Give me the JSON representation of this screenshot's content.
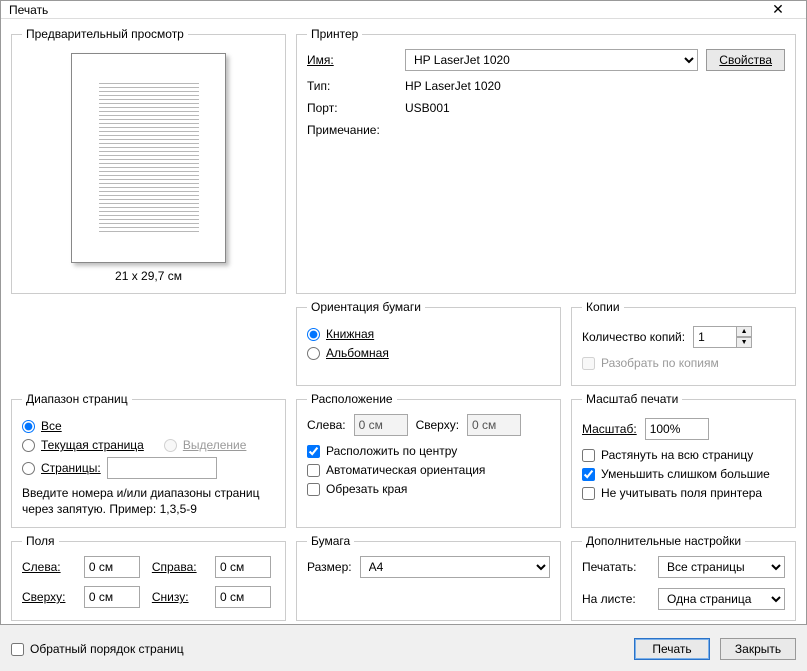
{
  "window": {
    "title": "Печать"
  },
  "preview": {
    "legend": "Предварительный просмотр",
    "dims": "21 x 29,7 см"
  },
  "printer": {
    "legend": "Принтер",
    "name_label": "Имя:",
    "name_value": "HP LaserJet 1020",
    "properties_btn": "Свойства",
    "type_label": "Тип:",
    "type_value": "HP LaserJet 1020",
    "port_label": "Порт:",
    "port_value": "USB001",
    "note_label": "Примечание:",
    "note_value": ""
  },
  "orientation": {
    "legend": "Ориентация бумаги",
    "portrait": "Книжная",
    "landscape": "Альбомная"
  },
  "copies": {
    "legend": "Копии",
    "count_label": "Количество копий:",
    "count_value": "1",
    "collate_label": "Разобрать по копиям"
  },
  "range": {
    "legend": "Диапазон страниц",
    "all": "Все",
    "current": "Текущая страница",
    "selection": "Выделение",
    "pages": "Страницы:",
    "pages_value": "",
    "hint": "Введите номера и/или диапазоны страниц через запятую. Пример: 1,3,5-9"
  },
  "layout": {
    "legend": "Расположение",
    "left_label": "Слева:",
    "left_value": "0 см",
    "top_label": "Сверху:",
    "top_value": "0 см",
    "center": "Расположить по центру",
    "auto_orient": "Автоматическая ориентация",
    "crop": "Обрезать края"
  },
  "scale": {
    "legend": "Масштаб печати",
    "scale_label": "Масштаб:",
    "scale_value": "100%",
    "fit": "Растянуть на всю страницу",
    "shrink": "Уменьшить слишком большие",
    "ignore_margins": "Не учитывать поля принтера"
  },
  "margins": {
    "legend": "Поля",
    "left_label": "Слева:",
    "left_value": "0 см",
    "right_label": "Справа:",
    "right_value": "0 см",
    "top_label": "Сверху:",
    "top_value": "0 см",
    "bottom_label": "Снизу:",
    "bottom_value": "0 см"
  },
  "paper": {
    "legend": "Бумага",
    "size_label": "Размер:",
    "size_value": "A4"
  },
  "extra": {
    "legend": "Дополнительные настройки",
    "print_label": "Печатать:",
    "print_value": "Все страницы",
    "sheet_label": "На листе:",
    "sheet_value": "Одна страница"
  },
  "bottom": {
    "reverse": "Обратный порядок страниц",
    "print_btn": "Печать",
    "close_btn": "Закрыть"
  }
}
